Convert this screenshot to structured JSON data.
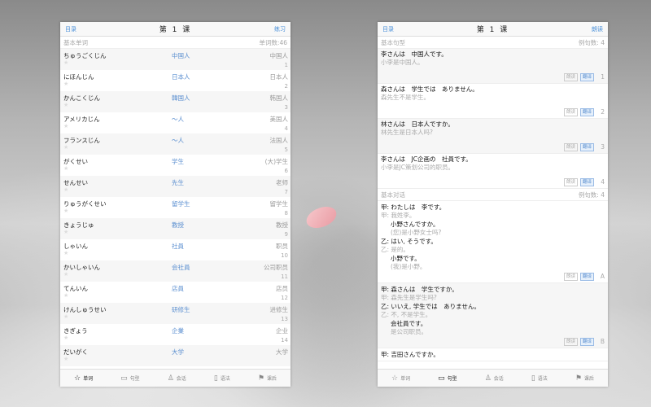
{
  "vocab_panel": {
    "header": {
      "left": "目录",
      "title": "第 1 课",
      "right": "练习"
    },
    "section": {
      "title": "基本单词",
      "count": "单词数:46"
    },
    "items": [
      {
        "kana": "ちゅうごくじん",
        "kanji": "中国人",
        "cn": "中国人",
        "num": "1"
      },
      {
        "kana": "にほんじん",
        "kanji": "日本人",
        "cn": "日本人",
        "num": "2"
      },
      {
        "kana": "かんこくじん",
        "kanji": "韓国人",
        "cn": "韩国人",
        "num": "3"
      },
      {
        "kana": "アメリカじん",
        "kanji": "～人",
        "cn": "美国人",
        "num": "4"
      },
      {
        "kana": "フランスじん",
        "kanji": "～人",
        "cn": "法国人",
        "num": "5"
      },
      {
        "kana": "がくせい",
        "kanji": "学生",
        "cn": "(大)学生",
        "num": "6"
      },
      {
        "kana": "せんせい",
        "kanji": "先生",
        "cn": "老师",
        "num": "7"
      },
      {
        "kana": "りゅうがくせい",
        "kanji": "留学生",
        "cn": "留学生",
        "num": "8"
      },
      {
        "kana": "きょうじゅ",
        "kanji": "教授",
        "cn": "教授",
        "num": "9"
      },
      {
        "kana": "しゃいん",
        "kanji": "社員",
        "cn": "职员",
        "num": "10"
      },
      {
        "kana": "かいしゃいん",
        "kanji": "会社員",
        "cn": "公司职员",
        "num": "11"
      },
      {
        "kana": "てんいん",
        "kanji": "店員",
        "cn": "店员",
        "num": "12"
      },
      {
        "kana": "けんしゅうせい",
        "kanji": "研修生",
        "cn": "进修生",
        "num": "13"
      },
      {
        "kana": "きぎょう",
        "kanji": "企業",
        "cn": "企业",
        "num": "14"
      },
      {
        "kana": "だいがく",
        "kanji": "大学",
        "cn": "大学",
        "num": ""
      }
    ],
    "star_icon": "star-icon"
  },
  "sentence_panel": {
    "header": {
      "left": "目录",
      "title": "第 1 课",
      "right": "朗读"
    },
    "section1": {
      "title": "基本句型",
      "count": "例句数: 4"
    },
    "sentences": [
      {
        "jp": "李さんは　中国人です。",
        "cn": "小李是中国人。",
        "num": "1"
      },
      {
        "jp": "森さんは　学生では　ありません。",
        "cn": "森先生不是学生。",
        "num": "2"
      },
      {
        "jp": "林さんは　日本人ですか。",
        "cn": "林先生是日本人吗?",
        "num": "3"
      },
      {
        "jp": "李さんは　JC企画の　社員です。",
        "cn": "小李是JC策划公司的职员。",
        "num": "4"
      }
    ],
    "section2": {
      "title": "基本对话",
      "count": "例句数: 4"
    },
    "dialogs": [
      {
        "lines": [
          {
            "jp": "甲: わたしは　李です。",
            "cn": "甲: 我姓李。",
            "indent": false
          },
          {
            "jp": "小野さんですか。",
            "cn": "(您)是小野女士吗?",
            "indent": true
          },
          {
            "jp": "乙: はい, そうです。",
            "cn": "乙: 是的。",
            "indent": false
          },
          {
            "jp": "小野です。",
            "cn": "(我)是小野。",
            "indent": true
          }
        ],
        "num": "A"
      },
      {
        "lines": [
          {
            "jp": "甲: 森さんは　学生ですか。",
            "cn": "甲: 森先生是学生吗?",
            "indent": false
          },
          {
            "jp": "乙: いいえ, 学生では　ありません。",
            "cn": "乙: 不, 不是学生。",
            "indent": false
          },
          {
            "jp": "会社員です。",
            "cn": "是公司职员。",
            "indent": true
          }
        ],
        "num": "B"
      },
      {
        "lines": [
          {
            "jp": "甲: 吉田さんですか。",
            "cn": "",
            "indent": false
          }
        ],
        "num": ""
      }
    ],
    "read_label": "朗读",
    "translate_label": "翻译"
  },
  "tabs": [
    {
      "label": "单词",
      "icon": "star-icon"
    },
    {
      "label": "句型",
      "icon": "card-icon"
    },
    {
      "label": "会话",
      "icon": "people-icon"
    },
    {
      "label": "语法",
      "icon": "book-icon"
    },
    {
      "label": "课后",
      "icon": "flag-icon"
    }
  ],
  "colors": {
    "accent": "#4a90d9",
    "petal": "#f2b3b9"
  }
}
